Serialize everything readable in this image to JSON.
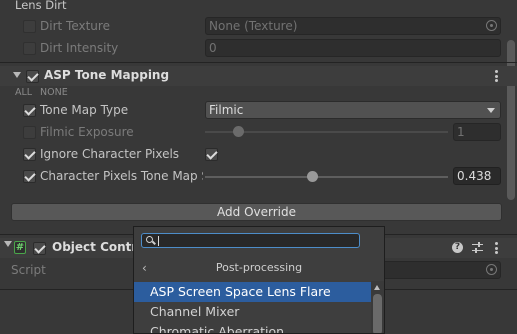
{
  "lens_dirt": {
    "title": "Lens Dirt",
    "dirt_texture": {
      "label": "Dirt Texture",
      "value": "None (Texture)",
      "enabled": false
    },
    "dirt_intensity": {
      "label": "Dirt Intensity",
      "value": "0",
      "enabled": false
    }
  },
  "tone_mapping": {
    "title": "ASP Tone Mapping",
    "enabled": true,
    "all_label": "ALL",
    "none_label": "NONE",
    "tone_map_type": {
      "label": "Tone Map Type",
      "value": "Filmic",
      "enabled": true
    },
    "filmic_exposure": {
      "label": "Filmic Exposure",
      "value": "1",
      "enabled": false,
      "slider_fraction": 0.12
    },
    "ignore_character_pixels": {
      "label": "Ignore Character Pixels",
      "enabled": true,
      "checked": true
    },
    "character_pixels_tone_map": {
      "label": "Character Pixels Tone Map S",
      "value": "0.438",
      "enabled": true,
      "slider_fraction": 0.438
    }
  },
  "add_override": {
    "label": "Add Override"
  },
  "object_control": {
    "title": "Object Contro",
    "enabled": true,
    "script_label": "Script"
  },
  "popup": {
    "search_value": "",
    "header": "Post-processing",
    "items": [
      {
        "label": "ASP Screen Space Lens Flare",
        "selected": true
      },
      {
        "label": "Channel Mixer",
        "selected": false
      },
      {
        "label": "Chromatic Aberration",
        "selected": false
      }
    ]
  },
  "colors": {
    "background": "#383838",
    "selection": "#2c5d9e",
    "focus_outline": "#4d8dc9",
    "script_icon": "#4aa64a"
  }
}
